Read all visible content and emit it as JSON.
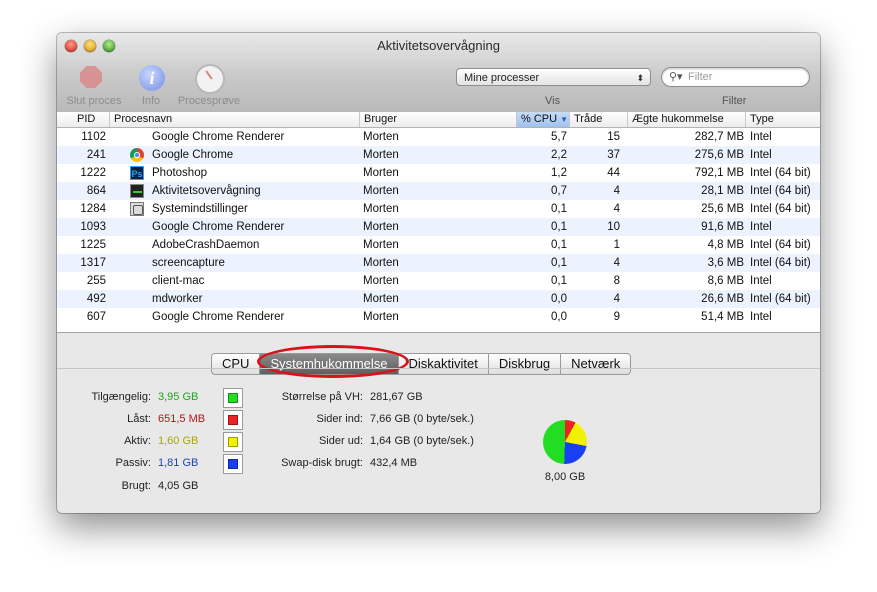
{
  "window": {
    "title": "Aktivitetsovervågning"
  },
  "toolbar": {
    "quit_label": "Slut proces",
    "info_label": "Info",
    "sample_label": "Procesprøve",
    "info_glyph": "i",
    "show_select": "Mine processer",
    "show_caption": "Vis",
    "filter_placeholder": "Filter",
    "filter_caption": "Filter"
  },
  "columns": {
    "pid": "PID",
    "name": "Procesnavn",
    "user": "Bruger",
    "cpu": "% CPU",
    "threads": "Tråde",
    "memory": "Ægte hukommelse",
    "type": "Type"
  },
  "processes": [
    {
      "pid": "1102",
      "icon": "none",
      "name": "Google Chrome Renderer",
      "user": "Morten",
      "cpu": "5,7",
      "threads": "15",
      "memory": "282,7 MB",
      "type": "Intel"
    },
    {
      "pid": "241",
      "icon": "chrome-icon",
      "name": "Google Chrome",
      "user": "Morten",
      "cpu": "2,2",
      "threads": "37",
      "memory": "275,6 MB",
      "type": "Intel"
    },
    {
      "pid": "1222",
      "icon": "photoshop-icon",
      "name": "Photoshop",
      "user": "Morten",
      "cpu": "1,2",
      "threads": "44",
      "memory": "792,1 MB",
      "type": "Intel (64 bit)"
    },
    {
      "pid": "864",
      "icon": "activity-monitor-icon",
      "name": "Aktivitetsovervågning",
      "user": "Morten",
      "cpu": "0,7",
      "threads": "4",
      "memory": "28,1 MB",
      "type": "Intel (64 bit)"
    },
    {
      "pid": "1284",
      "icon": "system-preferences-icon",
      "name": "Systemindstillinger",
      "user": "Morten",
      "cpu": "0,1",
      "threads": "4",
      "memory": "25,6 MB",
      "type": "Intel (64 bit)"
    },
    {
      "pid": "1093",
      "icon": "none",
      "name": "Google Chrome Renderer",
      "user": "Morten",
      "cpu": "0,1",
      "threads": "10",
      "memory": "91,6 MB",
      "type": "Intel"
    },
    {
      "pid": "1225",
      "icon": "none",
      "name": "AdobeCrashDaemon",
      "user": "Morten",
      "cpu": "0,1",
      "threads": "1",
      "memory": "4,8 MB",
      "type": "Intel (64 bit)"
    },
    {
      "pid": "1317",
      "icon": "none",
      "name": "screencapture",
      "user": "Morten",
      "cpu": "0,1",
      "threads": "4",
      "memory": "3,6 MB",
      "type": "Intel (64 bit)"
    },
    {
      "pid": "255",
      "icon": "none",
      "name": "client-mac",
      "user": "Morten",
      "cpu": "0,1",
      "threads": "8",
      "memory": "8,6 MB",
      "type": "Intel"
    },
    {
      "pid": "492",
      "icon": "none",
      "name": "mdworker",
      "user": "Morten",
      "cpu": "0,0",
      "threads": "4",
      "memory": "26,6 MB",
      "type": "Intel (64 bit)"
    },
    {
      "pid": "607",
      "icon": "none",
      "name": "Google Chrome Renderer",
      "user": "Morten",
      "cpu": "0,0",
      "threads": "9",
      "memory": "51,4 MB",
      "type": "Intel"
    }
  ],
  "tabs": [
    "CPU",
    "Systemhukommelse",
    "Diskaktivitet",
    "Diskbrug",
    "Netværk"
  ],
  "active_tab": "Systemhukommelse",
  "memory": {
    "free_label": "Tilgængelig:",
    "free_value": "3,95 GB",
    "free_color": "#1fa31f",
    "wired_label": "Låst:",
    "wired_value": "651,5 MB",
    "wired_color": "#b01818",
    "active_label": "Aktiv:",
    "active_value": "1,60 GB",
    "active_color": "#a8a800",
    "inactive_label": "Passiv:",
    "inactive_value": "1,81 GB",
    "inactive_color": "#1a3fc0",
    "used_label": "Brugt:",
    "used_value": "4,05 GB",
    "vm_size_label": "Størrelse på VH:",
    "vm_size_value": "281,67 GB",
    "page_ins_label": "Sider ind:",
    "page_ins_value": "7,66 GB (0 byte/sek.)",
    "page_outs_label": "Sider ud:",
    "page_outs_value": "1,64 GB (0 byte/sek.)",
    "swap_label": "Swap-disk brugt:",
    "swap_value": "432,4 MB",
    "total": "8,00 GB",
    "swatch_colors": {
      "free": "#22dd22",
      "wired": "#ee2222",
      "active": "#f2f200",
      "inactive": "#1a3ff0"
    }
  }
}
